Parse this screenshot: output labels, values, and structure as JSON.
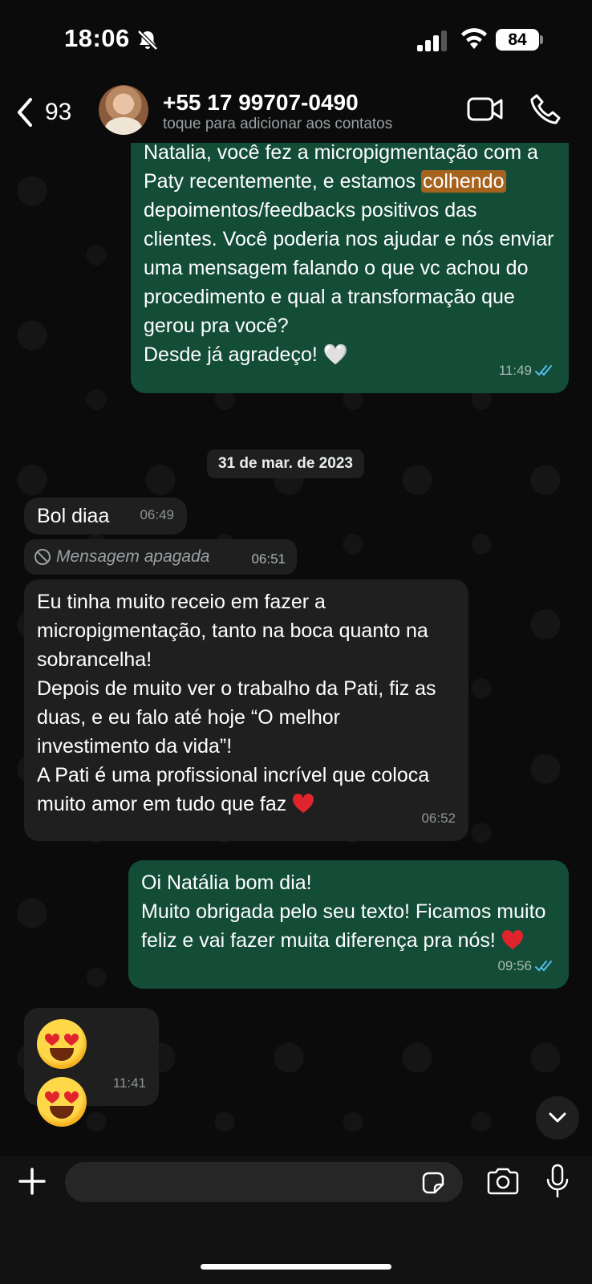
{
  "status_bar": {
    "time": "18:06",
    "battery": "84"
  },
  "header": {
    "back_count": "93",
    "contact_name": "+55 17 99707-0490",
    "contact_subtitle": "toque para adicionar aos contatos"
  },
  "messages": [
    {
      "direction": "outgoing",
      "text_before_highlight": "Natalia, você fez a micropigmentação com a Paty recentemente, e estamos ",
      "highlight": "colhendo",
      "text_after_highlight": " depoimentos/feedbacks positivos das clientes. Você poderia nos ajudar e nós enviar uma mensagem falando o que vc achou do procedimento e qual a transformação que gerou pra você?\nDesde já agradeço! 🤍",
      "time": "11:49"
    },
    {
      "direction": "date",
      "text": "31 de mar. de 2023"
    },
    {
      "direction": "incoming",
      "text": "Bol diaa",
      "time": "06:49"
    },
    {
      "direction": "incoming-deleted",
      "text": "Mensagem apagada",
      "time": "06:51"
    },
    {
      "direction": "incoming",
      "text": "Eu tinha muito receio em fazer a micropigmentação, tanto na boca quanto na sobrancelha!\nDepois de muito ver o trabalho da Pati, fiz as duas, e eu falo até hoje “O melhor investimento da vida”!\nA Pati é uma profissional incrível que coloca muito amor em tudo que faz",
      "time": "06:52"
    },
    {
      "direction": "outgoing",
      "text": "Oi Natália bom dia!\nMuito obrigada pelo seu texto! Ficamos muito feliz e vai fazer muita diferença pra nós!",
      "time": "09:56"
    },
    {
      "direction": "incoming",
      "text": "😍 😍",
      "time": "11:41"
    }
  ],
  "composer": {
    "placeholder": ""
  },
  "colors": {
    "outgoing_bubble": "#134d37",
    "incoming_bubble": "#1f1f1f",
    "read_ticks": "#53bdeb",
    "highlight": "#a5631e"
  }
}
